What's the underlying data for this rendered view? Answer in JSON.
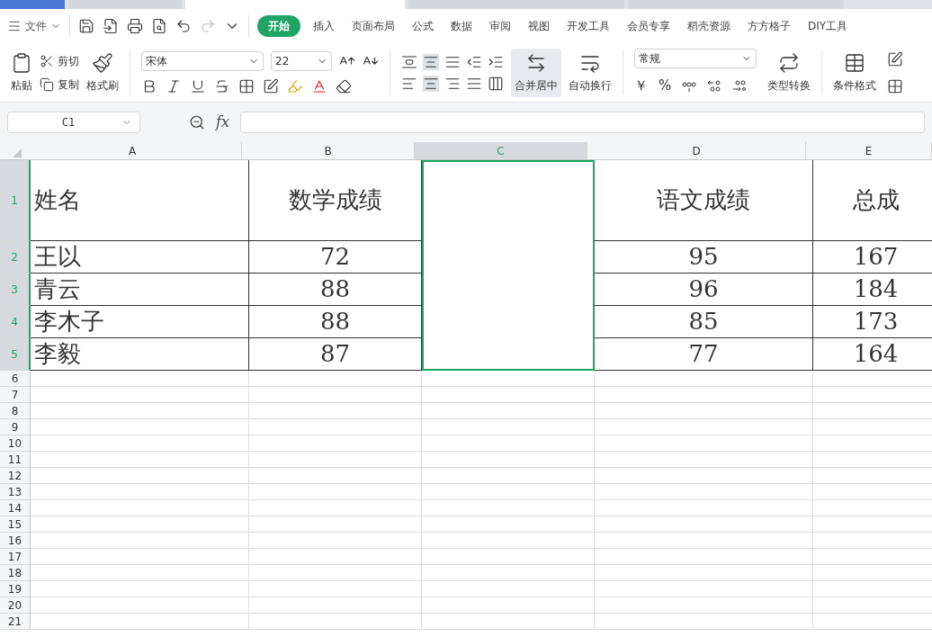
{
  "menu": {
    "file": "文件",
    "tabs": [
      {
        "label": "开始",
        "selected": true
      },
      {
        "label": "插入",
        "selected": false
      },
      {
        "label": "页面布局",
        "selected": false
      },
      {
        "label": "公式",
        "selected": false
      },
      {
        "label": "数据",
        "selected": false
      },
      {
        "label": "审阅",
        "selected": false
      },
      {
        "label": "视图",
        "selected": false
      },
      {
        "label": "开发工具",
        "selected": false
      },
      {
        "label": "会员专享",
        "selected": false
      },
      {
        "label": "稻壳资源",
        "selected": false
      },
      {
        "label": "方方格子",
        "selected": false
      },
      {
        "label": "DIY工具",
        "selected": false
      }
    ]
  },
  "ribbon": {
    "paste": "粘贴",
    "cut": "剪切",
    "copy": "复制",
    "format_painter": "格式刷",
    "font_name": "宋体",
    "font_size": "22",
    "merge": "合并居中",
    "wrap": "自动换行",
    "number_format": "常规",
    "currency": "￥",
    "percent": "%",
    "type_convert": "类型转换",
    "conditional_format": "条件格式"
  },
  "formula_bar": {
    "cell_ref": "C1",
    "fx": "fx"
  },
  "sheet": {
    "columns": [
      {
        "label": "A",
        "selected": false,
        "kind": "text"
      },
      {
        "label": "B",
        "selected": false,
        "kind": "number"
      },
      {
        "label": "C",
        "selected": true,
        "kind": "number"
      },
      {
        "label": "D",
        "selected": false,
        "kind": "number"
      },
      {
        "label": "E",
        "selected": false,
        "kind": "number"
      }
    ],
    "rows": [
      {
        "header": "1",
        "kind": "title",
        "selected": true,
        "cells": [
          "姓名",
          "数学成绩",
          null,
          "语文成绩",
          "总成"
        ]
      },
      {
        "header": "2",
        "kind": "data",
        "selected": true,
        "cells": [
          "王以",
          "72",
          null,
          "95",
          "167"
        ]
      },
      {
        "header": "3",
        "kind": "data",
        "selected": true,
        "cells": [
          "青云",
          "88",
          null,
          "96",
          "184"
        ]
      },
      {
        "header": "4",
        "kind": "data",
        "selected": true,
        "cells": [
          "李木子",
          "88",
          null,
          "85",
          "173"
        ]
      },
      {
        "header": "5",
        "kind": "data",
        "selected": true,
        "cells": [
          "李毅",
          "87",
          null,
          "77",
          "164"
        ]
      },
      {
        "header": "6",
        "kind": "blank",
        "selected": false,
        "cells": []
      },
      {
        "header": "7",
        "kind": "blank",
        "selected": false,
        "cells": []
      },
      {
        "header": "8",
        "kind": "blank",
        "selected": false,
        "cells": []
      },
      {
        "header": "9",
        "kind": "blank",
        "selected": false,
        "cells": []
      },
      {
        "header": "10",
        "kind": "blank",
        "selected": false,
        "cells": []
      },
      {
        "header": "11",
        "kind": "blank",
        "selected": false,
        "cells": []
      },
      {
        "header": "12",
        "kind": "blank",
        "selected": false,
        "cells": []
      },
      {
        "header": "13",
        "kind": "blank",
        "selected": false,
        "cells": []
      },
      {
        "header": "14",
        "kind": "blank",
        "selected": false,
        "cells": []
      },
      {
        "header": "15",
        "kind": "blank",
        "selected": false,
        "cells": []
      },
      {
        "header": "16",
        "kind": "blank",
        "selected": false,
        "cells": []
      },
      {
        "header": "17",
        "kind": "blank",
        "selected": false,
        "cells": []
      },
      {
        "header": "18",
        "kind": "blank",
        "selected": false,
        "cells": []
      },
      {
        "header": "19",
        "kind": "blank",
        "selected": false,
        "cells": []
      },
      {
        "header": "20",
        "kind": "blank",
        "selected": false,
        "cells": []
      },
      {
        "header": "21",
        "kind": "blank",
        "selected": false,
        "cells": []
      }
    ]
  }
}
